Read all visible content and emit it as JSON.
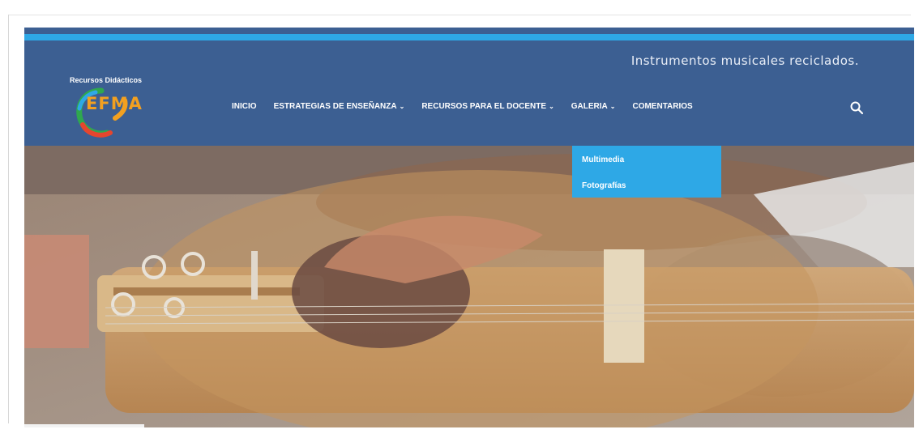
{
  "header": {
    "tagline": "Instrumentos musicales reciclados.",
    "logo_caption": "Recursos Didácticos",
    "logo_text": "EFMA"
  },
  "nav": {
    "items": [
      {
        "label": "INICIO",
        "has_dropdown": false
      },
      {
        "label": "ESTRATEGIAS DE ENSEÑANZA",
        "has_dropdown": true
      },
      {
        "label": "RECURSOS PARA EL DOCENTE",
        "has_dropdown": true
      },
      {
        "label": "GALERIA",
        "has_dropdown": true
      },
      {
        "label": "COMENTARIOS",
        "has_dropdown": false
      }
    ],
    "search_icon": "search-icon"
  },
  "galeria_dropdown": {
    "items": [
      "Multimedia",
      "Fotografías"
    ]
  },
  "colors": {
    "header": "#3c5f92",
    "accent": "#2ea8e6"
  }
}
